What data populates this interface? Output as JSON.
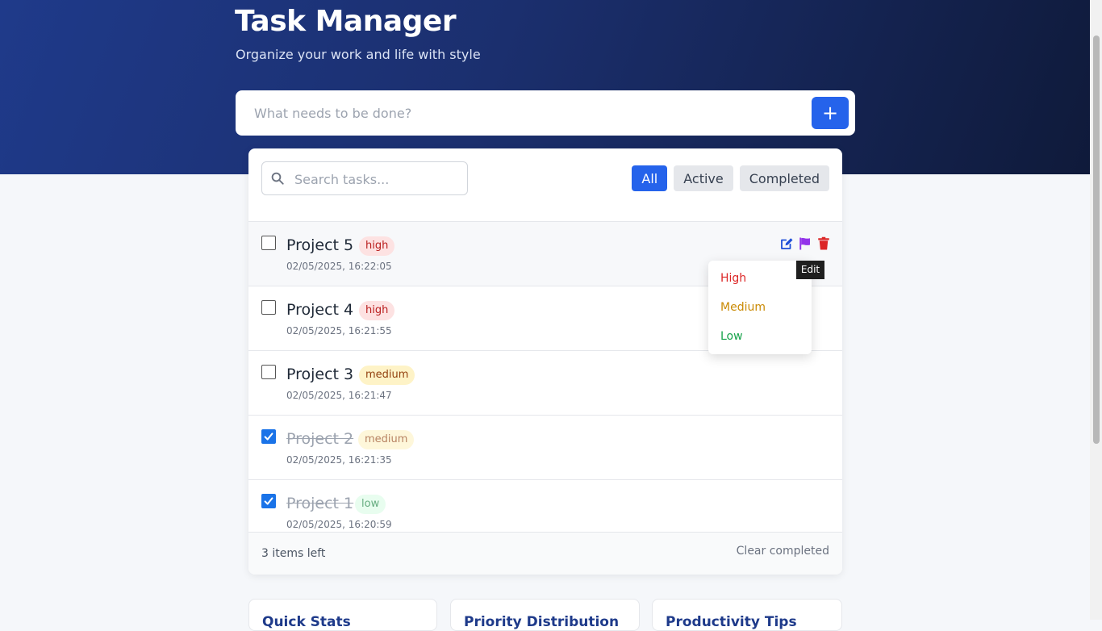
{
  "header": {
    "title": "Task Manager",
    "subtitle": "Organize your work and life with style"
  },
  "new_task": {
    "placeholder": "What needs to be done?",
    "add_label": "+"
  },
  "search": {
    "placeholder": "Search tasks..."
  },
  "filters": [
    {
      "label": "All",
      "active": true
    },
    {
      "label": "Active",
      "active": false
    },
    {
      "label": "Completed",
      "active": false
    }
  ],
  "tasks": [
    {
      "title": "Project 5",
      "priority": "high",
      "date": "02/05/2025, 16:22:05",
      "completed": false
    },
    {
      "title": "Project 4",
      "priority": "high",
      "date": "02/05/2025, 16:21:55",
      "completed": false
    },
    {
      "title": "Project 3",
      "priority": "medium",
      "date": "02/05/2025, 16:21:47",
      "completed": false
    },
    {
      "title": "Project 2",
      "priority": "medium",
      "date": "02/05/2025, 16:21:35",
      "completed": true
    },
    {
      "title": "Project 1",
      "priority": "low",
      "date": "02/05/2025, 16:20:59",
      "completed": true
    }
  ],
  "priority_menu": {
    "options": [
      {
        "label": "High",
        "color": "#dc2626"
      },
      {
        "label": "Medium",
        "color": "#ca8a04"
      },
      {
        "label": "Low",
        "color": "#16a34a"
      }
    ]
  },
  "tooltip": "Edit",
  "footer": {
    "items_left": "3 items left",
    "clear_label": "Clear completed"
  },
  "stats_cards": [
    {
      "label": "Quick Stats"
    },
    {
      "label": "Priority Distribution"
    },
    {
      "label": "Productivity Tips"
    }
  ],
  "colors": {
    "accent": "#2563eb",
    "edit_icon": "#1d4ed8",
    "flag_icon": "#9333ea",
    "delete_icon": "#dc2626"
  }
}
